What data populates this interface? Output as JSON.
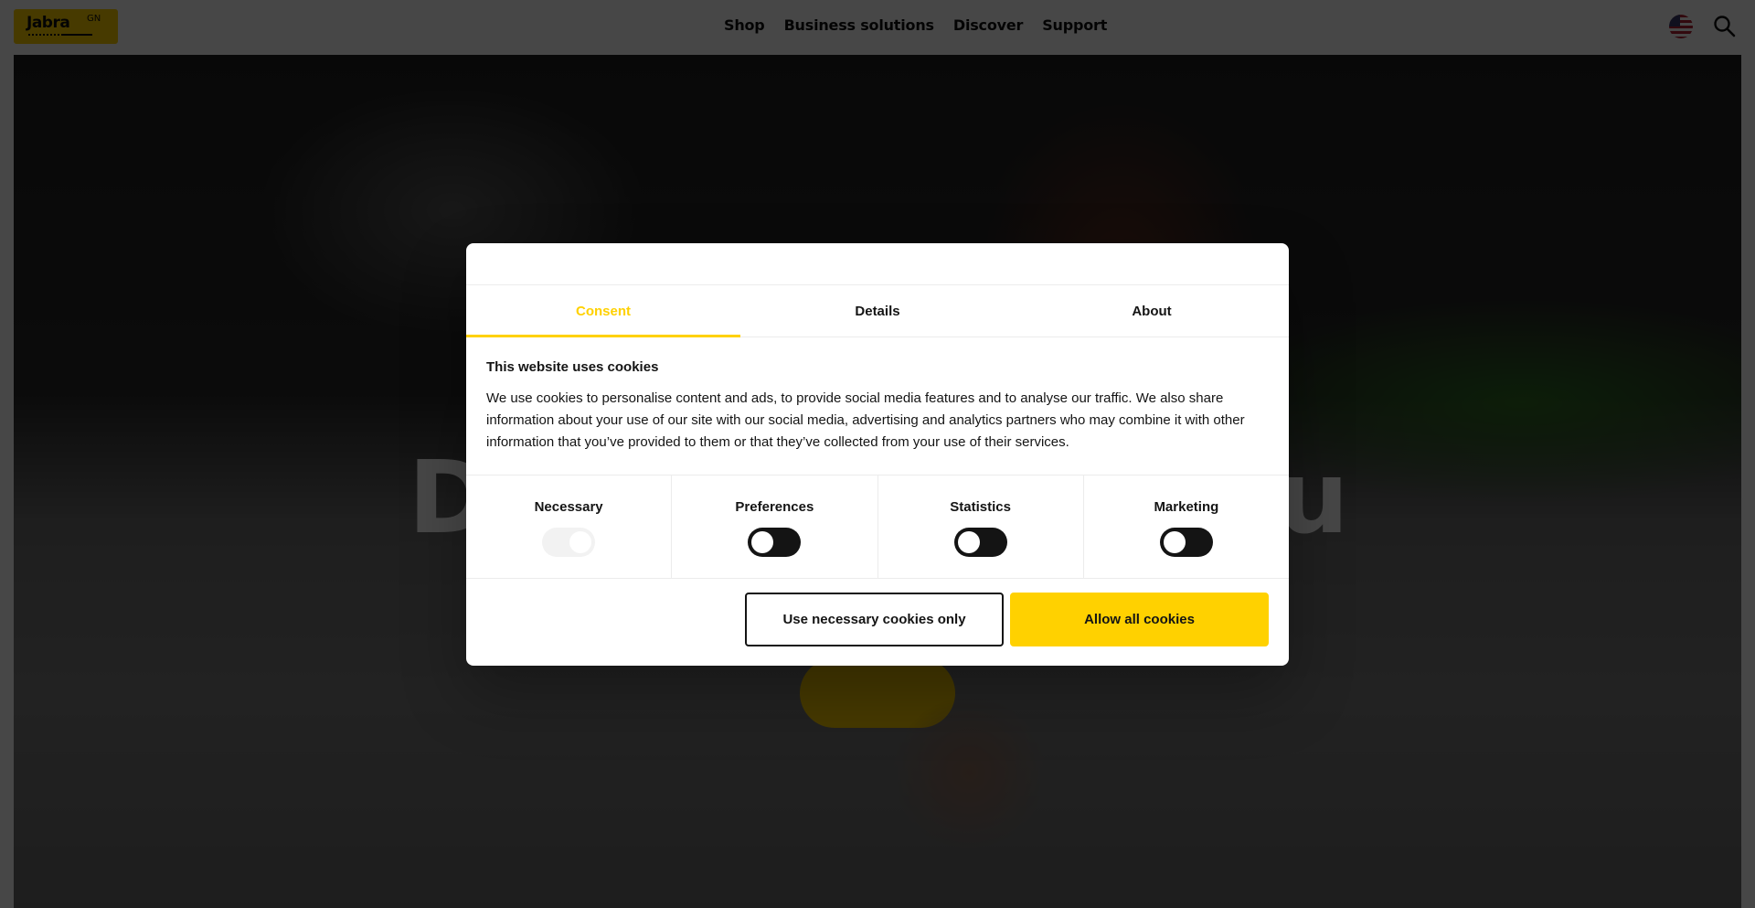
{
  "header": {
    "logo": {
      "word": "Jabra",
      "suffix": "GN"
    },
    "nav": [
      "Shop",
      "Business solutions",
      "Discover",
      "Support"
    ],
    "icons": {
      "region": "us-flag-icon",
      "search": "search-icon"
    }
  },
  "hero": {
    "title": "Designed for you"
  },
  "cookie_dialog": {
    "tabs": [
      {
        "label": "Consent",
        "active": true
      },
      {
        "label": "Details",
        "active": false
      },
      {
        "label": "About",
        "active": false
      }
    ],
    "title": "This website uses cookies",
    "text": "We use cookies to personalise content and ads, to provide social media features and to analyse our traffic. We also share information about your use of our site with our social media, advertising and analytics partners who may combine it with other information that you’ve provided to them or that they’ve collected from your use of their services.",
    "categories": [
      {
        "label": "Necessary",
        "checked": true,
        "disabled": true
      },
      {
        "label": "Preferences",
        "checked": false,
        "disabled": false
      },
      {
        "label": "Statistics",
        "checked": false,
        "disabled": false
      },
      {
        "label": "Marketing",
        "checked": false,
        "disabled": false
      }
    ],
    "buttons": {
      "necessary_only": "Use necessary cookies only",
      "allow_all": "Allow all cookies"
    }
  },
  "colors": {
    "brand_yellow": "#ffd100",
    "text_dark": "#141414",
    "overlay": "rgba(0,0,0,0.72)"
  }
}
